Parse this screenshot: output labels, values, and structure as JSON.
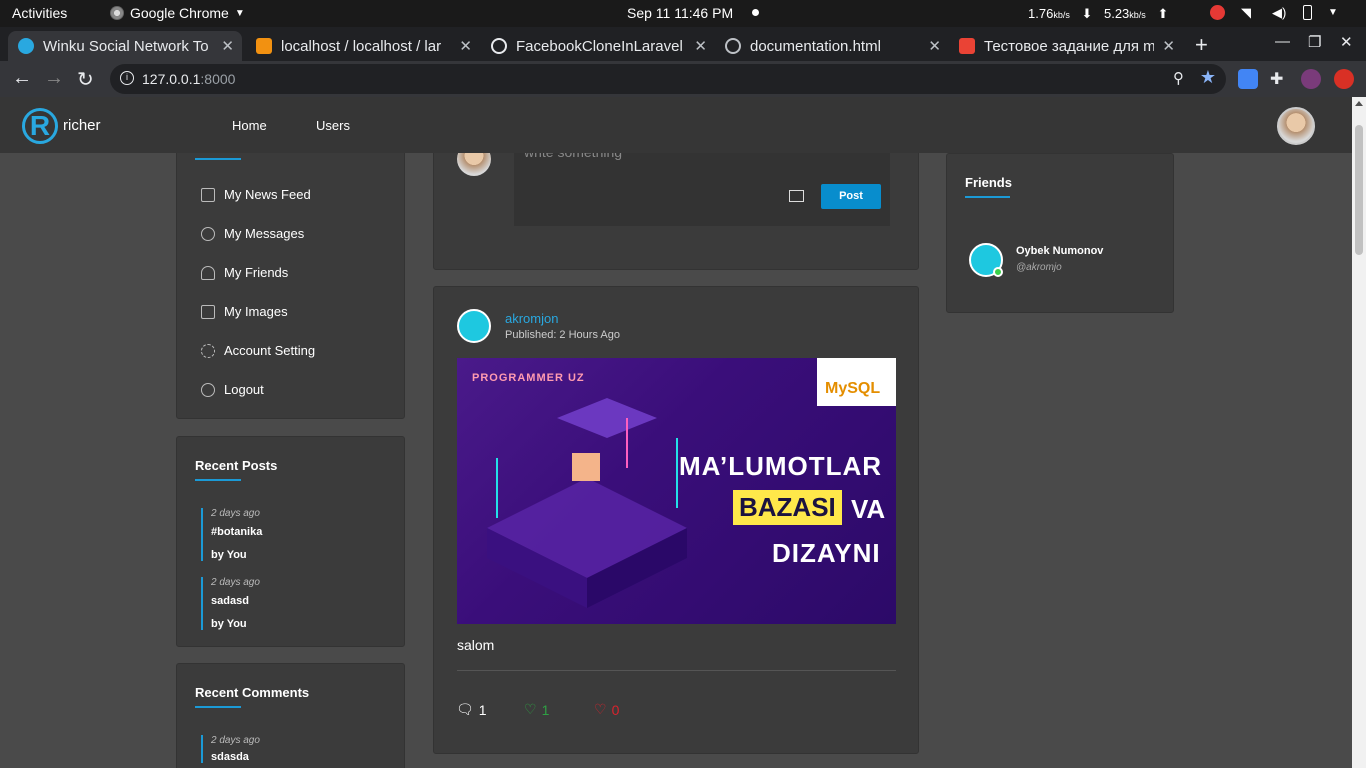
{
  "system_bar": {
    "activities": "Activities",
    "app_name": "Google Chrome",
    "clock": "Sep 11  11:46 PM",
    "net_down": "1.76",
    "net_down_unit": "kb/s",
    "net_up": "5.23",
    "net_up_unit": "kb/s"
  },
  "tabs": [
    {
      "title": "Winku Social Network To",
      "active": true,
      "favicon": "winku-icon",
      "color": "#29a8e0"
    },
    {
      "title": "localhost / localhost / lar",
      "active": false,
      "favicon": "phpmyadmin-icon",
      "color": "#f29111"
    },
    {
      "title": "FacebookCloneInLaravel",
      "active": false,
      "favicon": "github-icon",
      "color": "#ffffff"
    },
    {
      "title": "documentation.html",
      "active": false,
      "favicon": "globe-icon",
      "color": "#bdc1c6"
    },
    {
      "title": "Тестовое задание для m",
      "active": false,
      "favicon": "gmail-icon",
      "color": "#ea4335"
    }
  ],
  "address": {
    "host": "127.0.0.1",
    "port": ":8000"
  },
  "site": {
    "logo_letter": "R",
    "brand": "richer",
    "nav": [
      "Home",
      "Users"
    ]
  },
  "sidebar": {
    "menu": [
      {
        "label": "My News Feed",
        "icon": "newspaper-icon"
      },
      {
        "label": "My Messages",
        "icon": "message-icon"
      },
      {
        "label": "My Friends",
        "icon": "user-icon"
      },
      {
        "label": "My Images",
        "icon": "image-icon"
      },
      {
        "label": "Account Setting",
        "icon": "gear-icon"
      },
      {
        "label": "Logout",
        "icon": "power-icon"
      }
    ],
    "recent_posts": {
      "title": "Recent Posts",
      "items": [
        {
          "ago": "2 days ago",
          "title": "#botanika",
          "by": "by You"
        },
        {
          "ago": "2 days ago",
          "title": "sadasd",
          "by": "by You"
        }
      ]
    },
    "recent_comments": {
      "title": "Recent Comments",
      "items": [
        {
          "ago": "2 days ago",
          "title": "sdasda"
        }
      ]
    }
  },
  "composer": {
    "placeholder": "write something",
    "post_button": "Post"
  },
  "post": {
    "author": "akromjon",
    "published": "Published: 2 Hours Ago",
    "image": {
      "brand": "PROGRAMMER UZ",
      "logo": "MySQL",
      "line1": "MA’LUMOTLAR",
      "line2_highlight": "BAZASI",
      "line2_rest": "VA",
      "line3": "DIZAYNI"
    },
    "text": "salom",
    "comments": "1",
    "likes": "1",
    "dislikes": "0",
    "like_color": "#2ea043",
    "dislike_color": "#d9232d"
  },
  "friends": {
    "title": "Friends",
    "items": [
      {
        "name": "Oybek Numonov",
        "handle": "@akromjo",
        "online": true
      }
    ]
  }
}
